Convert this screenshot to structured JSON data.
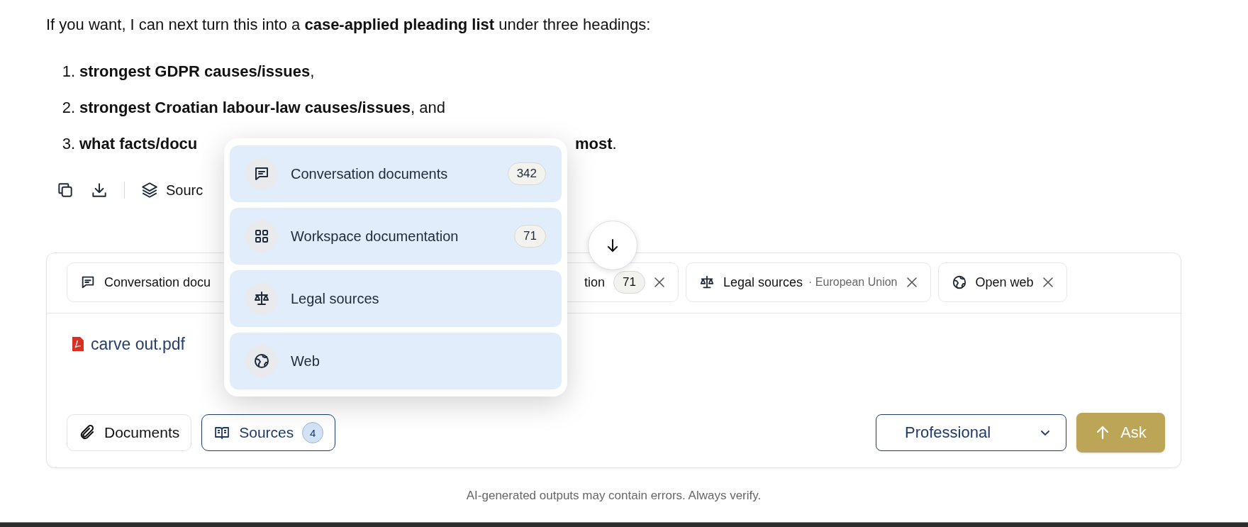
{
  "message": {
    "intro": "If you want, I can next turn this into a **case-applied pleading list** under three headings:",
    "items": [
      {
        "number": "1.",
        "text": "**strongest GDPR causes/issues**,"
      },
      {
        "number": "2.",
        "text": "**strongest Croatian labour-law causes/issues**, and"
      },
      {
        "number": "3.",
        "text": "**what facts/docu**",
        "text_after": "**most**."
      }
    ]
  },
  "actions": {
    "sources_label": "Sourc"
  },
  "sources_menu": {
    "options": [
      {
        "kind": "chat",
        "label": "Conversation documents",
        "count": "342"
      },
      {
        "kind": "grid",
        "label": "Workspace documentation",
        "count": "71"
      },
      {
        "kind": "scale",
        "label": "Legal sources"
      },
      {
        "kind": "globe",
        "label": "Web"
      }
    ]
  },
  "composer": {
    "chips": [
      {
        "kind": "chat",
        "label": "Conversation docu"
      },
      {
        "label": "tion",
        "count": "71",
        "removable": true
      },
      {
        "kind": "scale",
        "label": "Legal sources",
        "detail": "· European Union",
        "removable": true
      },
      {
        "kind": "globe",
        "label": "Open web",
        "removable": true
      }
    ],
    "attachment": {
      "name": "carve out.pdf"
    },
    "documents_button": "Documents",
    "sources_button": {
      "label": "Sources",
      "count": "4",
      "active": true
    },
    "mode": {
      "value": "Professional"
    },
    "ask_button": "Ask"
  },
  "footer": "AI-generated outputs may contain errors. Always verify."
}
